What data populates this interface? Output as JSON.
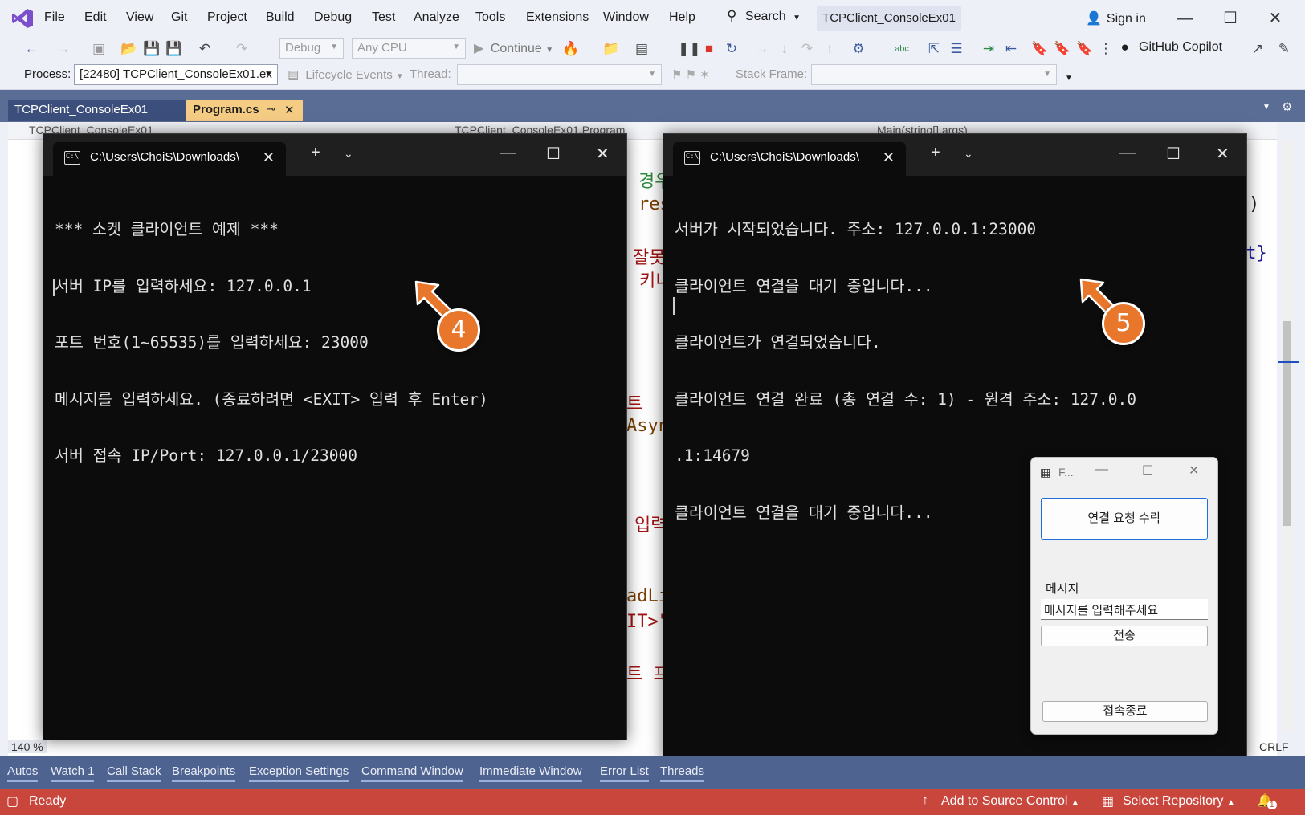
{
  "menu": {
    "items": [
      "File",
      "Edit",
      "View",
      "Git",
      "Project",
      "Build",
      "Debug",
      "Test",
      "Analyze",
      "Tools",
      "Extensions",
      "Window",
      "Help"
    ],
    "search_label": "Search",
    "solution_title": "TCPClient_ConsoleEx01",
    "sign_in": "Sign in"
  },
  "toolbar": {
    "config": "Debug",
    "platform": "Any CPU",
    "continue_label": "Continue",
    "copilot_label": "GitHub Copilot"
  },
  "process_bar": {
    "process_label": "Process:",
    "process_value": "[22480] TCPClient_ConsoleEx01.ex",
    "lifecycle_label": "Lifecycle Events",
    "thread_label": "Thread:",
    "stack_frame_label": "Stack Frame:"
  },
  "doc_tabs": {
    "project_tab": "TCPClient_ConsoleEx01",
    "file_tab": "Program.cs"
  },
  "editor": {
    "nav_project": "TCPClient_ConsoleEx01",
    "nav_class": "TCPClient_ConsoleEx01.Program",
    "nav_method": "Main(string[] args)",
    "zoom": "140 %",
    "line_ending": "CRLF"
  },
  "client_terminal": {
    "title": "C:\\Users\\ChoiS\\Downloads\\",
    "lines": [
      "*** 소켓 클라이언트 예제 ***",
      "서버 IP를 입력하세요: 127.0.0.1",
      "포트 번호(1~65535)를 입력하세요: 23000",
      "메시지를 입력하세요. (종료하려면 <EXIT> 입력 후 Enter)",
      "서버 접속 IP/Port: 127.0.0.1/23000"
    ]
  },
  "server_terminal": {
    "title": "C:\\Users\\ChoiS\\Downloads\\",
    "lines": [
      "서버가 시작되었습니다. 주소: 127.0.0.1:23000",
      "클라이언트 연결을 대기 중입니다...",
      "클라이언트가 연결되었습니다.",
      "클라이언트 연결 완료 (총 연결 수: 1) - 원격 주소: 127.0.0",
      ".1:14679",
      "클라이언트 연결을 대기 중입니다..."
    ]
  },
  "callouts": {
    "client": "4",
    "server": "5"
  },
  "form": {
    "title": "F...",
    "accept_button": "연결 요청 수락",
    "message_label": "메시지",
    "message_placeholder": "메시지를 입력해주세요",
    "send_button": "전송",
    "disconnect_button": "접속종료"
  },
  "bottom_tabs": [
    "Autos",
    "Watch 1",
    "Call Stack",
    "Breakpoints",
    "Exception Settings",
    "Command Window",
    "Immediate Window",
    "Error List",
    "Threads"
  ],
  "status_bar": {
    "ready": "Ready",
    "add_source_control": "Add to Source Control",
    "select_repository": "Select Repository",
    "notifications": "1"
  },
  "colors": {
    "status_bar": "#c9463d",
    "active_tab": "#f5cc84",
    "callout": "#e8762b"
  }
}
